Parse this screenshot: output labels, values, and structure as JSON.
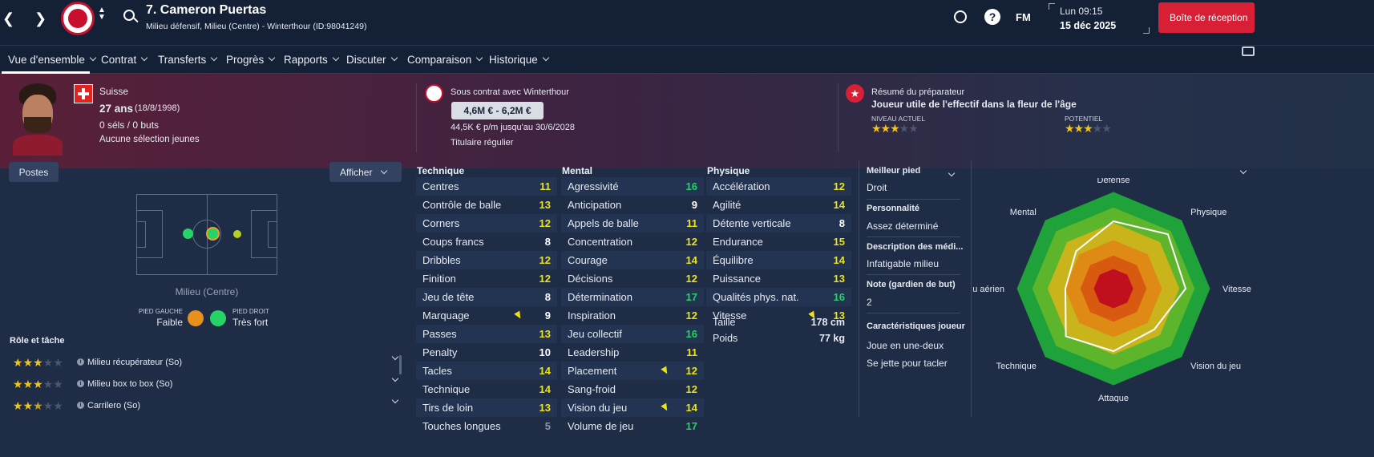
{
  "header": {
    "title": "7. Cameron Puertas",
    "subtitle": "Milieu défensif, Milieu (Centre) - Winterthour (ID:98041249)",
    "fm_label": "FM",
    "time": "Lun 09:15",
    "date": "15 déc 2025",
    "inbox_button": "Boîte de réception"
  },
  "nav": [
    "Vue d'ensemble",
    "Contrat",
    "Transferts",
    "Progrès",
    "Rapports",
    "Discuter",
    "Comparaison",
    "Historique"
  ],
  "profile": {
    "nationality": "Suisse",
    "age": "27 ans",
    "dob": "(18/8/1998)",
    "caps": "0 séls / 0 buts",
    "youth": "Aucune sélection jeunes",
    "contract_club": "Sous contrat avec Winterthour",
    "value": "4,6M € - 6,2M €",
    "wage": "44,5K € p/m jusqu'au 30/6/2028",
    "status": "Titulaire régulier",
    "coach_title": "Résumé du préparateur",
    "coach_summary": "Joueur utile de l'effectif dans la fleur de l'âge",
    "current_label": "NIVEAU ACTUEL",
    "potential_label": "POTENTIEL",
    "current_stars": 3,
    "potential_stars": 3
  },
  "positions": {
    "button": "Postes",
    "show_button": "Afficher",
    "position_label": "Milieu (Centre)",
    "left_foot_label": "PIED GAUCHE",
    "left_foot": "Faible",
    "right_foot_label": "PIED DROIT",
    "right_foot": "Très fort",
    "role_title": "Rôle et tâche",
    "roles": [
      {
        "name": "Milieu récupérateur (So)",
        "stars": 3
      },
      {
        "name": "Milieu box to box (So)",
        "stars": 3
      },
      {
        "name": "Carrilero (So)",
        "stars": 2.5
      }
    ]
  },
  "attributes": {
    "technique_title": "Technique",
    "mental_title": "Mental",
    "physique_title": "Physique",
    "technique": [
      [
        "Centres",
        "11"
      ],
      [
        "Contrôle de balle",
        "13"
      ],
      [
        "Corners",
        "12"
      ],
      [
        "Coups francs",
        "8"
      ],
      [
        "Dribbles",
        "12"
      ],
      [
        "Finition",
        "12"
      ],
      [
        "Jeu de tête",
        "8"
      ],
      [
        "Marquage",
        "9"
      ],
      [
        "Passes",
        "13"
      ],
      [
        "Penalty",
        "10"
      ],
      [
        "Tacles",
        "14"
      ],
      [
        "Technique",
        "14"
      ],
      [
        "Tirs de loin",
        "13"
      ],
      [
        "Touches longues",
        "5"
      ]
    ],
    "mental": [
      [
        "Agressivité",
        "16"
      ],
      [
        "Anticipation",
        "9"
      ],
      [
        "Appels de balle",
        "11"
      ],
      [
        "Concentration",
        "12"
      ],
      [
        "Courage",
        "14"
      ],
      [
        "Décisions",
        "12"
      ],
      [
        "Détermination",
        "17"
      ],
      [
        "Inspiration",
        "12"
      ],
      [
        "Jeu collectif",
        "16"
      ],
      [
        "Leadership",
        "11"
      ],
      [
        "Placement",
        "12"
      ],
      [
        "Sang-froid",
        "12"
      ],
      [
        "Vision du jeu",
        "14"
      ],
      [
        "Volume de jeu",
        "17"
      ]
    ],
    "physique": [
      [
        "Accélération",
        "12"
      ],
      [
        "Agilité",
        "14"
      ],
      [
        "Détente verticale",
        "8"
      ],
      [
        "Endurance",
        "15"
      ],
      [
        "Équilibre",
        "14"
      ],
      [
        "Puissance",
        "13"
      ],
      [
        "Qualités phys. nat.",
        "16"
      ],
      [
        "Vitesse",
        "13"
      ]
    ],
    "height_label": "Taille",
    "height": "178 cm",
    "weight_label": "Poids",
    "weight": "77 kg"
  },
  "info": {
    "best_foot_label": "Meilleur pied",
    "best_foot": "Droit",
    "personality_label": "Personnalité",
    "personality": "Assez déterminé",
    "media_label": "Description des médi...",
    "media": "Infatigable milieu",
    "gk_label": "Note (gardien de but)",
    "gk": "2",
    "traits_label": "Caractéristiques joueur",
    "traits": [
      "Joue en une-deux",
      "Se jette pour tacler"
    ]
  },
  "radar": {
    "labels": [
      "Défense",
      "Physique",
      "Vitesse",
      "Vision du jeu",
      "Attaque",
      "Technique",
      "Jeu aérien",
      "Mental"
    ],
    "values": [
      0.7,
      0.8,
      0.75,
      0.6,
      0.65,
      0.7,
      0.5,
      0.55
    ]
  },
  "colors": {
    "good": "#25d366",
    "mid": "#e9e21c",
    "accent": "#d71f35"
  }
}
